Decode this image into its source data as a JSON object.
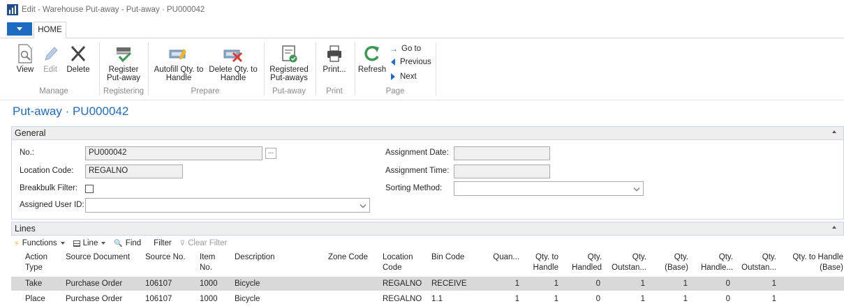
{
  "window": {
    "title": "Edit - Warehouse Put-away - Put-away · PU000042"
  },
  "ribbon": {
    "tabs": [
      "HOME"
    ],
    "groups": [
      {
        "label": "Manage",
        "buttons": [
          "View",
          "Edit",
          "Delete"
        ]
      },
      {
        "label": "Registering",
        "buttons": [
          "Register Put-away"
        ]
      },
      {
        "label": "Prepare",
        "buttons": [
          "Autofill Qty. to Handle",
          "Delete Qty. to Handle"
        ]
      },
      {
        "label": "Put-away",
        "buttons": [
          "Registered Put-aways"
        ]
      },
      {
        "label": "Print",
        "buttons": [
          "Print..."
        ]
      },
      {
        "label": "Page",
        "buttons": [
          "Refresh",
          "Go to",
          "Previous",
          "Next"
        ]
      }
    ],
    "view": "View",
    "edit": "Edit",
    "delete": "Delete",
    "register_l1": "Register",
    "register_l2": "Put-away",
    "autofill_l1": "Autofill Qty. to",
    "autofill_l2": "Handle",
    "delqty_l1": "Delete Qty. to",
    "delqty_l2": "Handle",
    "registered_l1": "Registered",
    "registered_l2": "Put-aways",
    "print": "Print...",
    "refresh": "Refresh",
    "goto": "Go to",
    "previous": "Previous",
    "next": "Next",
    "group_manage": "Manage",
    "group_registering": "Registering",
    "group_prepare": "Prepare",
    "group_putaway": "Put-away",
    "group_print": "Print",
    "group_page": "Page"
  },
  "page": {
    "title": "Put-away · PU000042"
  },
  "general": {
    "header": "General",
    "no_label": "No.:",
    "no_value": "PU000042",
    "lookup": "...",
    "location_label": "Location Code:",
    "location_value": "REGALNO",
    "breakbulk_label": "Breakbulk Filter:",
    "breakbulk_checked": false,
    "assigned_user_label": "Assigned User ID:",
    "assigned_user_value": "",
    "assignment_date_label": "Assignment Date:",
    "assignment_date_value": "",
    "assignment_time_label": "Assignment Time:",
    "assignment_time_value": "",
    "sorting_label": "Sorting Method:",
    "sorting_value": ""
  },
  "lines": {
    "header": "Lines",
    "toolbar": {
      "functions": "Functions",
      "line": "Line",
      "find": "Find",
      "filter": "Filter",
      "clear_filter": "Clear Filter"
    },
    "columns": {
      "action_type_1": "Action",
      "action_type_2": "Type",
      "source_document": "Source Document",
      "source_no": "Source No.",
      "item_no_1": "Item",
      "item_no_2": "No.",
      "description": "Description",
      "zone_code": "Zone Code",
      "location_code_1": "Location",
      "location_code_2": "Code",
      "bin_code": "Bin Code",
      "quantity": "Quan...",
      "qty_to_handle_1": "Qty. to",
      "qty_to_handle_2": "Handle",
      "qty_handled_1": "Qty.",
      "qty_handled_2": "Handled",
      "qty_outstanding_1": "Qty.",
      "qty_outstanding_2": "Outstan...",
      "qty_base_1": "Qty.",
      "qty_base_2": "(Base)",
      "qty_handled_base_1": "Qty.",
      "qty_handled_base_2": "Handle...",
      "qty_outstanding_base_1": "Qty.",
      "qty_outstanding_base_2": "Outstan...",
      "qty_to_handle_base_1": "Qty. to Handle",
      "qty_to_handle_base_2": "(Base)"
    },
    "rows": [
      {
        "action_type": "Take",
        "source_document": "Purchase Order",
        "source_no": "106107",
        "item_no": "1000",
        "description": "Bicycle",
        "zone_code": "",
        "location_code": "REGALNO",
        "bin_code": "RECEIVE",
        "quantity": "1",
        "qty_to_handle": "1",
        "qty_handled": "0",
        "qty_outstanding": "1",
        "qty_base": "1",
        "qty_handled_base": "0",
        "qty_outstanding_base": "1",
        "qty_to_handle_base": ""
      },
      {
        "action_type": "Place",
        "source_document": "Purchase Order",
        "source_no": "106107",
        "item_no": "1000",
        "description": "Bicycle",
        "zone_code": "",
        "location_code": "REGALNO",
        "bin_code": "1.1",
        "quantity": "1",
        "qty_to_handle": "1",
        "qty_handled": "0",
        "qty_outstanding": "1",
        "qty_base": "1",
        "qty_handled_base": "0",
        "qty_outstanding_base": "1",
        "qty_to_handle_base": ""
      }
    ]
  },
  "colors": {
    "accent": "#1f6bc4",
    "selected_row": "#d9d9d9",
    "panel_header": "#eeeeee"
  }
}
